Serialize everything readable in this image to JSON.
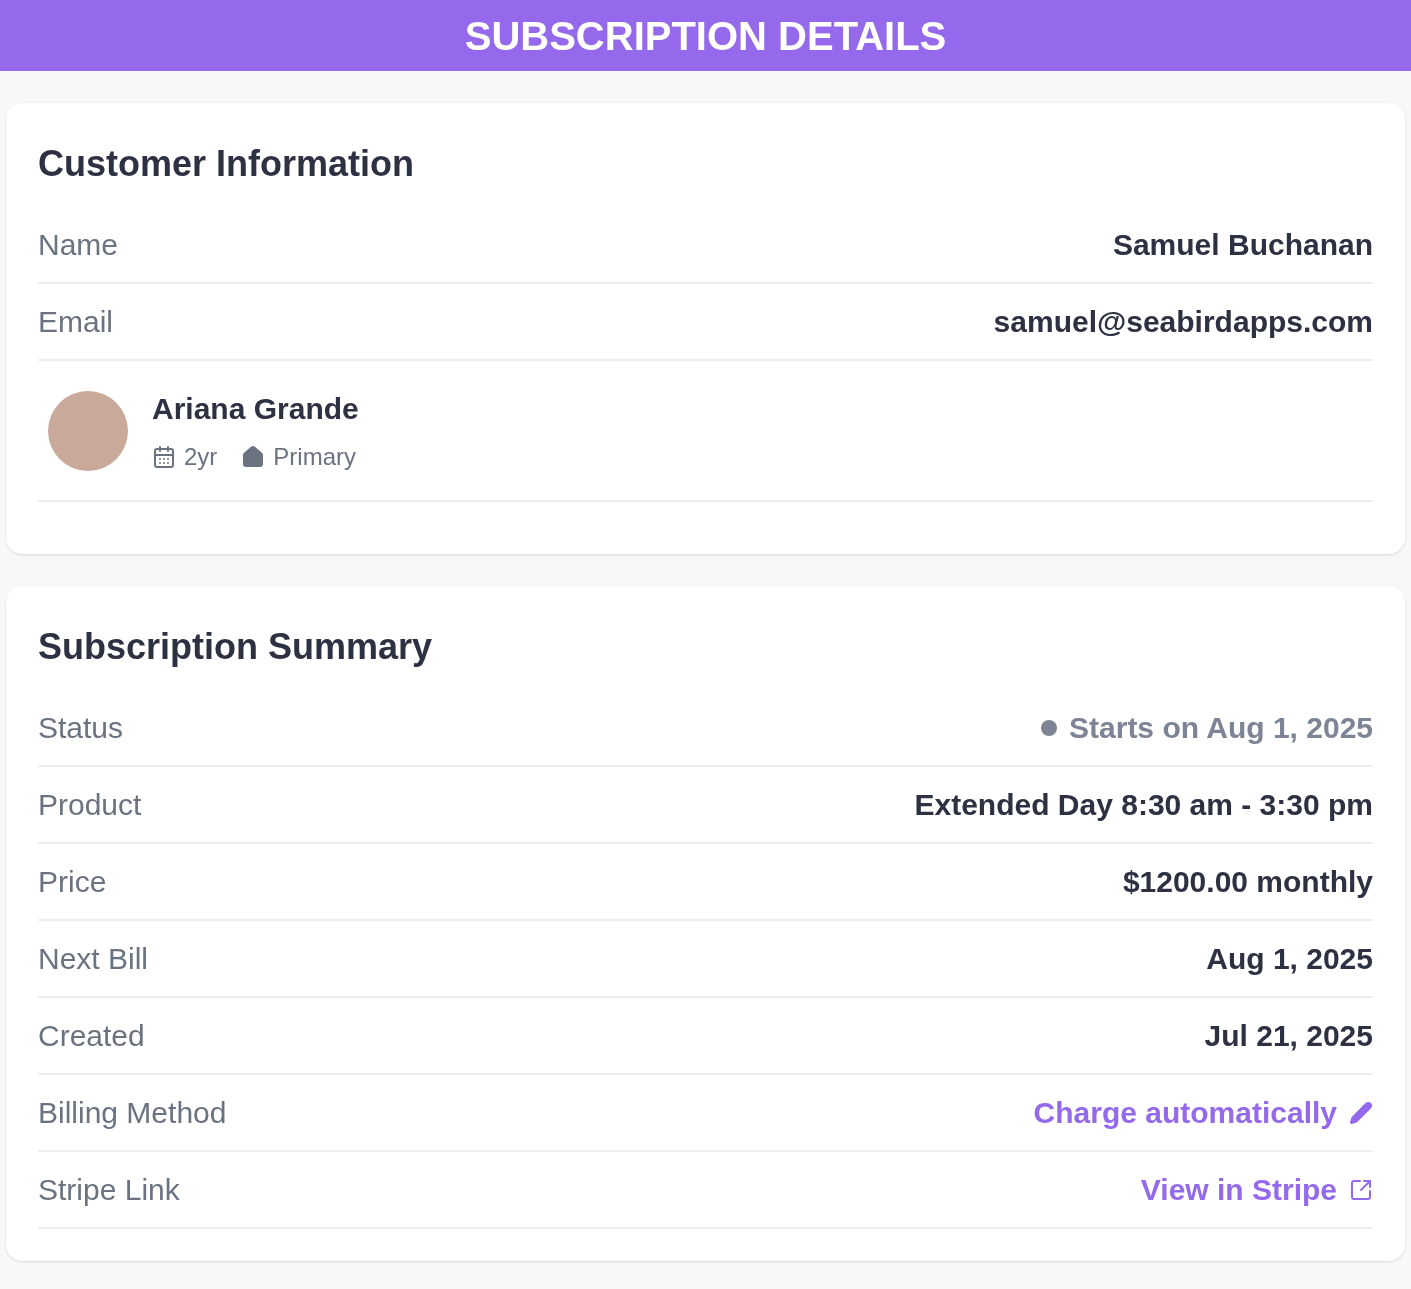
{
  "header": {
    "title": "SUBSCRIPTION DETAILS"
  },
  "customer": {
    "title": "Customer Information",
    "fields": [
      {
        "label": "Name",
        "value": "Samuel Buchanan"
      },
      {
        "label": "Email",
        "value": "samuel@seabirdapps.com"
      }
    ],
    "child": {
      "name": "Ariana Grande",
      "age": "2yr",
      "role": "Primary"
    }
  },
  "summary": {
    "title": "Subscription Summary",
    "rows": [
      {
        "kind": "status",
        "label": "Status",
        "value": "Starts on Aug 1, 2025",
        "color": "#7c8495"
      },
      {
        "kind": "text",
        "label": "Product",
        "value": "Extended Day 8:30 am - 3:30 pm"
      },
      {
        "kind": "text",
        "label": "Price",
        "value": "$1200.00 monthly"
      },
      {
        "kind": "text",
        "label": "Next Bill",
        "value": "Aug 1, 2025"
      },
      {
        "kind": "text",
        "label": "Created",
        "value": "Jul 21, 2025"
      },
      {
        "kind": "edit-link",
        "label": "Billing Method",
        "value": "Charge automatically"
      },
      {
        "kind": "external-link",
        "label": "Stripe Link",
        "value": "View in Stripe"
      }
    ]
  }
}
